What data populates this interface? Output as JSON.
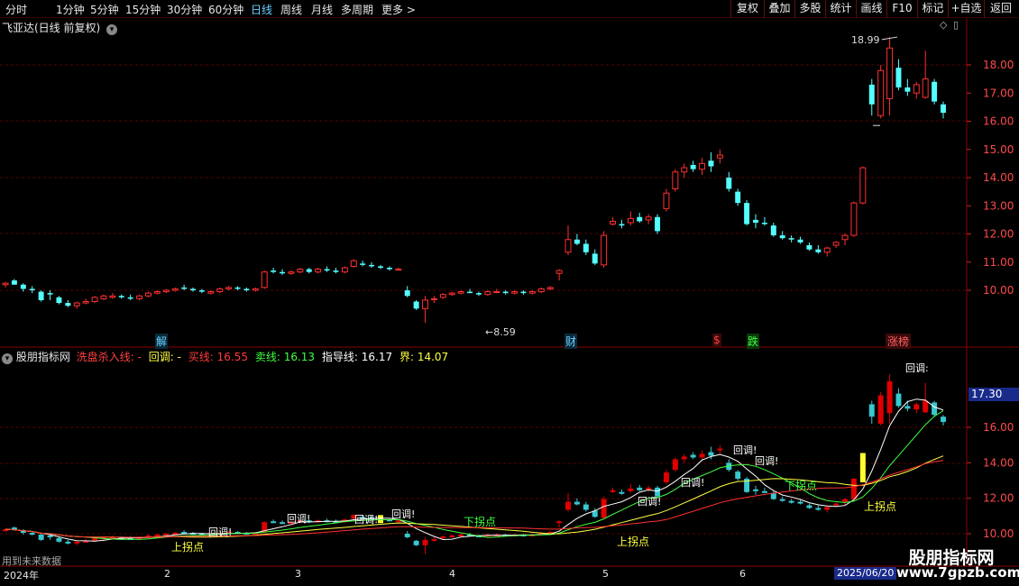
{
  "toolbar": {
    "tabs": [
      "分时",
      "1分钟",
      "5分钟",
      "15分钟",
      "30分钟",
      "60分钟",
      "日线",
      "周线",
      "月线",
      "多周期",
      "更多 >"
    ],
    "active_tab": "日线",
    "buttons": [
      "复权",
      "叠加",
      "多股",
      "统计",
      "画线",
      "F10",
      "标记",
      "+自选",
      "返回"
    ]
  },
  "main_panel": {
    "stock_title": "飞亚达(日线 前复权)",
    "price_axis": [
      "18.00",
      "17.00",
      "16.00",
      "15.00",
      "14.00",
      "13.00",
      "12.00",
      "11.00",
      "10.00"
    ],
    "high_marker": "18.99",
    "low_marker": "8.59",
    "event_labels": [
      "解",
      "财",
      "$",
      "跌",
      "涨榜"
    ]
  },
  "indicator_panel": {
    "name": "股朋指标网",
    "fields": [
      {
        "label": "洗盘杀入线:",
        "value": "-",
        "color": "#ff4040"
      },
      {
        "label": "回调:",
        "value": "-",
        "color": "#ffff40"
      },
      {
        "label": "买线:",
        "value": "16.55",
        "color": "#ff3a3a"
      },
      {
        "label": "卖线:",
        "value": "16.13",
        "color": "#40ff40"
      },
      {
        "label": "指导线:",
        "value": "16.17",
        "color": "#ffffff"
      },
      {
        "label": "界:",
        "value": "14.07",
        "color": "#ffff40"
      }
    ],
    "axis": [
      "16.00",
      "14.00",
      "12.00",
      "10.00"
    ],
    "current_value": "17.30",
    "signals": {
      "pullback": "回调!",
      "pullback_short": "回调:",
      "up_turn": "上拐点",
      "down_turn": "下拐点"
    },
    "note": "用到未来数据"
  },
  "time_axis": {
    "labels": [
      "2024年",
      "2",
      "3",
      "4",
      "5",
      "6"
    ],
    "current_date": "2025/06/20"
  },
  "watermark": {
    "title": "股朋指标网",
    "url": "www.7gpzb.com"
  },
  "chart_data": {
    "type": "candlestick",
    "series_name": "飞亚达",
    "ylim": [
      8.3,
      19.3
    ],
    "ticks": [
      10,
      11,
      12,
      13,
      14,
      15,
      16,
      17,
      18
    ],
    "candles": [
      [
        10.2,
        10.3,
        10.1,
        10.25
      ],
      [
        10.35,
        10.4,
        10.2,
        10.2
      ],
      [
        10.2,
        10.25,
        9.95,
        10.05
      ],
      [
        10.05,
        10.15,
        9.9,
        10.0
      ],
      [
        9.95,
        10.0,
        9.6,
        9.65
      ],
      [
        9.9,
        10.0,
        9.65,
        9.85
      ],
      [
        9.75,
        9.8,
        9.5,
        9.55
      ],
      [
        9.55,
        9.65,
        9.4,
        9.45
      ],
      [
        9.45,
        9.6,
        9.35,
        9.55
      ],
      [
        9.55,
        9.7,
        9.5,
        9.6
      ],
      [
        9.6,
        9.8,
        9.55,
        9.75
      ],
      [
        9.7,
        9.85,
        9.65,
        9.8
      ],
      [
        9.75,
        9.9,
        9.7,
        9.8
      ],
      [
        9.8,
        9.85,
        9.7,
        9.75
      ],
      [
        9.75,
        9.85,
        9.65,
        9.7
      ],
      [
        9.7,
        9.85,
        9.65,
        9.8
      ],
      [
        9.8,
        9.95,
        9.75,
        9.9
      ],
      [
        9.9,
        10.0,
        9.85,
        9.95
      ],
      [
        9.95,
        10.05,
        9.9,
        10.0
      ],
      [
        10.0,
        10.1,
        9.95,
        10.05
      ],
      [
        10.1,
        10.2,
        10.0,
        10.05
      ],
      [
        10.05,
        10.1,
        9.95,
        10.0
      ],
      [
        10.0,
        10.05,
        9.9,
        9.95
      ],
      [
        9.9,
        10.0,
        9.85,
        9.95
      ],
      [
        9.95,
        10.1,
        9.9,
        10.05
      ],
      [
        10.05,
        10.15,
        10.0,
        10.1
      ],
      [
        10.1,
        10.15,
        10.0,
        10.05
      ],
      [
        10.05,
        10.1,
        9.95,
        10.0
      ],
      [
        10.0,
        10.1,
        9.95,
        10.05
      ],
      [
        10.1,
        10.7,
        10.05,
        10.65
      ],
      [
        10.7,
        10.8,
        10.6,
        10.65
      ],
      [
        10.65,
        10.75,
        10.55,
        10.6
      ],
      [
        10.6,
        10.7,
        10.55,
        10.65
      ],
      [
        10.65,
        10.8,
        10.6,
        10.75
      ],
      [
        10.75,
        10.8,
        10.6,
        10.65
      ],
      [
        10.65,
        10.8,
        10.6,
        10.75
      ],
      [
        10.75,
        10.85,
        10.65,
        10.7
      ],
      [
        10.7,
        10.8,
        10.6,
        10.65
      ],
      [
        10.65,
        10.85,
        10.6,
        10.8
      ],
      [
        10.85,
        11.1,
        10.8,
        11.05
      ],
      [
        10.95,
        11.05,
        10.85,
        10.9
      ],
      [
        10.9,
        11.0,
        10.8,
        10.85
      ],
      [
        10.85,
        10.9,
        10.75,
        10.8
      ],
      [
        10.8,
        10.85,
        10.7,
        10.75
      ],
      [
        10.75,
        10.8,
        10.7,
        10.75
      ],
      [
        10.0,
        10.15,
        9.75,
        9.8
      ],
      [
        9.6,
        9.65,
        9.3,
        9.35
      ],
      [
        9.35,
        9.8,
        8.85,
        9.65
      ],
      [
        9.7,
        9.8,
        9.55,
        9.7
      ],
      [
        9.75,
        9.9,
        9.7,
        9.85
      ],
      [
        9.85,
        9.95,
        9.8,
        9.9
      ],
      [
        9.9,
        10.0,
        9.85,
        9.95
      ],
      [
        9.95,
        10.05,
        9.9,
        9.9
      ],
      [
        9.9,
        9.95,
        9.8,
        9.85
      ],
      [
        9.85,
        10.0,
        9.8,
        9.95
      ],
      [
        9.95,
        10.05,
        9.9,
        9.95
      ],
      [
        9.95,
        10.0,
        9.85,
        9.9
      ],
      [
        9.9,
        10.0,
        9.85,
        9.95
      ],
      [
        9.95,
        10.0,
        9.85,
        9.9
      ],
      [
        9.9,
        10.0,
        9.85,
        9.95
      ],
      [
        9.95,
        10.1,
        9.9,
        10.05
      ],
      [
        10.05,
        10.15,
        10.0,
        10.1
      ],
      [
        10.6,
        10.75,
        10.35,
        10.7
      ],
      [
        11.35,
        12.3,
        11.25,
        11.8
      ],
      [
        11.8,
        12.0,
        11.6,
        11.65
      ],
      [
        11.65,
        11.8,
        11.25,
        11.35
      ],
      [
        11.3,
        11.45,
        10.9,
        10.95
      ],
      [
        10.9,
        12.1,
        10.8,
        11.95
      ],
      [
        12.35,
        12.6,
        12.3,
        12.45
      ],
      [
        12.35,
        12.5,
        12.2,
        12.3
      ],
      [
        12.4,
        12.8,
        12.3,
        12.55
      ],
      [
        12.6,
        12.75,
        12.4,
        12.45
      ],
      [
        12.5,
        12.7,
        12.35,
        12.6
      ],
      [
        12.6,
        12.7,
        12.0,
        12.1
      ],
      [
        12.9,
        13.6,
        12.8,
        13.45
      ],
      [
        13.6,
        14.3,
        13.5,
        14.2
      ],
      [
        14.2,
        14.5,
        14.0,
        14.35
      ],
      [
        14.45,
        14.6,
        14.2,
        14.3
      ],
      [
        14.3,
        14.7,
        14.1,
        14.5
      ],
      [
        14.6,
        14.9,
        14.2,
        14.4
      ],
      [
        14.7,
        15.0,
        14.5,
        14.8
      ],
      [
        14.0,
        14.2,
        13.5,
        13.6
      ],
      [
        13.5,
        13.6,
        13.0,
        13.1
      ],
      [
        13.1,
        13.2,
        12.3,
        12.35
      ],
      [
        12.5,
        12.7,
        12.2,
        12.4
      ],
      [
        12.4,
        12.6,
        12.3,
        12.35
      ],
      [
        12.3,
        12.4,
        11.9,
        11.95
      ],
      [
        11.95,
        12.1,
        11.8,
        11.85
      ],
      [
        11.85,
        11.95,
        11.7,
        11.8
      ],
      [
        11.8,
        11.9,
        11.65,
        11.7
      ],
      [
        11.6,
        11.7,
        11.4,
        11.45
      ],
      [
        11.45,
        11.6,
        11.3,
        11.35
      ],
      [
        11.35,
        11.55,
        11.2,
        11.5
      ],
      [
        11.6,
        11.75,
        11.5,
        11.7
      ],
      [
        11.8,
        12.0,
        11.6,
        11.95
      ],
      [
        11.95,
        13.15,
        11.9,
        13.1
      ],
      [
        13.1,
        14.4,
        13.05,
        14.35
      ],
      [
        17.3,
        17.5,
        16.2,
        16.6
      ],
      [
        16.2,
        18.0,
        16.1,
        17.8
      ],
      [
        16.8,
        18.99,
        16.2,
        18.6
      ],
      [
        17.9,
        18.2,
        17.1,
        17.2
      ],
      [
        17.2,
        17.5,
        16.9,
        17.05
      ],
      [
        17.0,
        17.4,
        16.8,
        17.3
      ],
      [
        16.85,
        18.5,
        16.8,
        17.5
      ],
      [
        17.4,
        17.5,
        16.6,
        16.7
      ],
      [
        16.6,
        16.7,
        16.1,
        16.3
      ]
    ]
  }
}
